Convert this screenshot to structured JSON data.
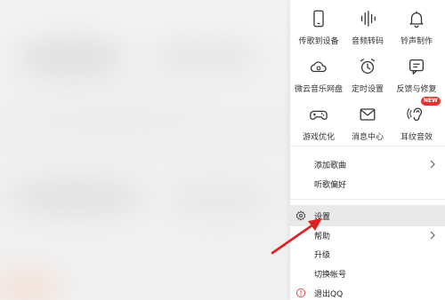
{
  "tools": [
    {
      "label": "传歌到设备",
      "icon": "phone-icon"
    },
    {
      "label": "音频转码",
      "icon": "soundwave-icon"
    },
    {
      "label": "铃声制作",
      "icon": "bell-icon"
    },
    {
      "label": "微云音乐网盘",
      "icon": "cloud-icon"
    },
    {
      "label": "定时设置",
      "icon": "alarm-clock-icon"
    },
    {
      "label": "反馈与修复",
      "icon": "feedback-icon"
    },
    {
      "label": "游戏优化",
      "icon": "gamepad-icon"
    },
    {
      "label": "消息中心",
      "icon": "mail-icon"
    },
    {
      "label": "耳纹音效",
      "icon": "ear-icon",
      "badge": "NEW"
    }
  ],
  "menu": {
    "add_song": "添加歌曲",
    "listen_pref": "听歌偏好",
    "settings": "设置",
    "help": "帮助",
    "upgrade": "升级",
    "switch_account": "切换帐号",
    "quit": "退出QQ"
  },
  "colors": {
    "highlight": "#e9e9e9",
    "badge": "#e3342f",
    "arrow": "#e02020",
    "quit_icon": "#e34b4b"
  }
}
